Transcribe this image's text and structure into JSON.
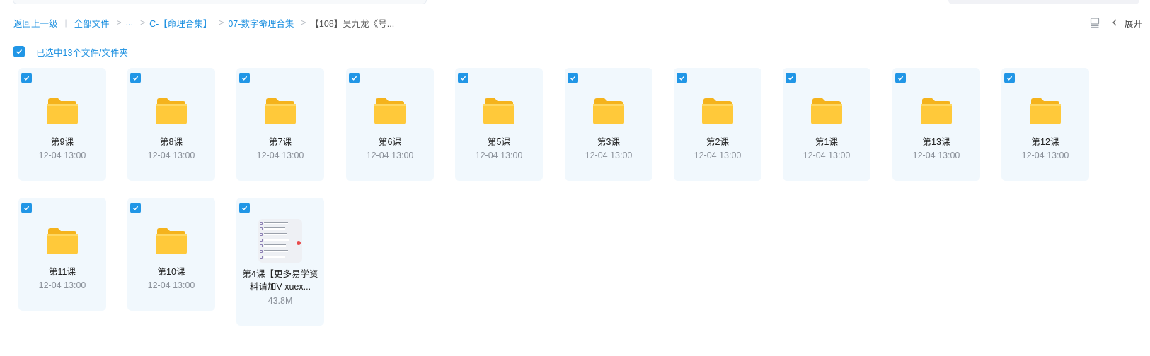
{
  "breadcrumb": {
    "back": "返回上一级",
    "separator_bar": "|",
    "separator": ">",
    "items": [
      "全部文件",
      "...",
      "C-【命理合集】",
      "07-数字命理合集"
    ],
    "current": "【108】吴九龙《号..."
  },
  "top_right": {
    "list_view_icon": "list-view-icon",
    "collapse_icon": "chevron-left-icon",
    "expand_label": "展开"
  },
  "selection": {
    "checked": true,
    "label": "已选中13个文件/文件夹"
  },
  "items": [
    {
      "type": "folder",
      "name": "第9课",
      "date": "12-04 13:00",
      "checked": true
    },
    {
      "type": "folder",
      "name": "第8课",
      "date": "12-04 13:00",
      "checked": true
    },
    {
      "type": "folder",
      "name": "第7课",
      "date": "12-04 13:00",
      "checked": true
    },
    {
      "type": "folder",
      "name": "第6课",
      "date": "12-04 13:00",
      "checked": true
    },
    {
      "type": "folder",
      "name": "第5课",
      "date": "12-04 13:00",
      "checked": true
    },
    {
      "type": "folder",
      "name": "第3课",
      "date": "12-04 13:00",
      "checked": true
    },
    {
      "type": "folder",
      "name": "第2课",
      "date": "12-04 13:00",
      "checked": true
    },
    {
      "type": "folder",
      "name": "第1课",
      "date": "12-04 13:00",
      "checked": true
    },
    {
      "type": "folder",
      "name": "第13课",
      "date": "12-04 13:00",
      "checked": true
    },
    {
      "type": "folder",
      "name": "第12课",
      "date": "12-04 13:00",
      "checked": true
    },
    {
      "type": "folder",
      "name": "第11课",
      "date": "12-04 13:00",
      "checked": true
    },
    {
      "type": "folder",
      "name": "第10课",
      "date": "12-04 13:00",
      "checked": true
    }
  ],
  "file": {
    "type": "file",
    "name_line1": "第4课【更多易学资",
    "name_line2": "料请加V xuex...",
    "size": "43.8M",
    "checked": true
  },
  "colors": {
    "accent": "#2196e6",
    "link": "#1a8fe0",
    "card_bg": "#f1f8fd",
    "folder_yellow": "#ffc93a"
  }
}
